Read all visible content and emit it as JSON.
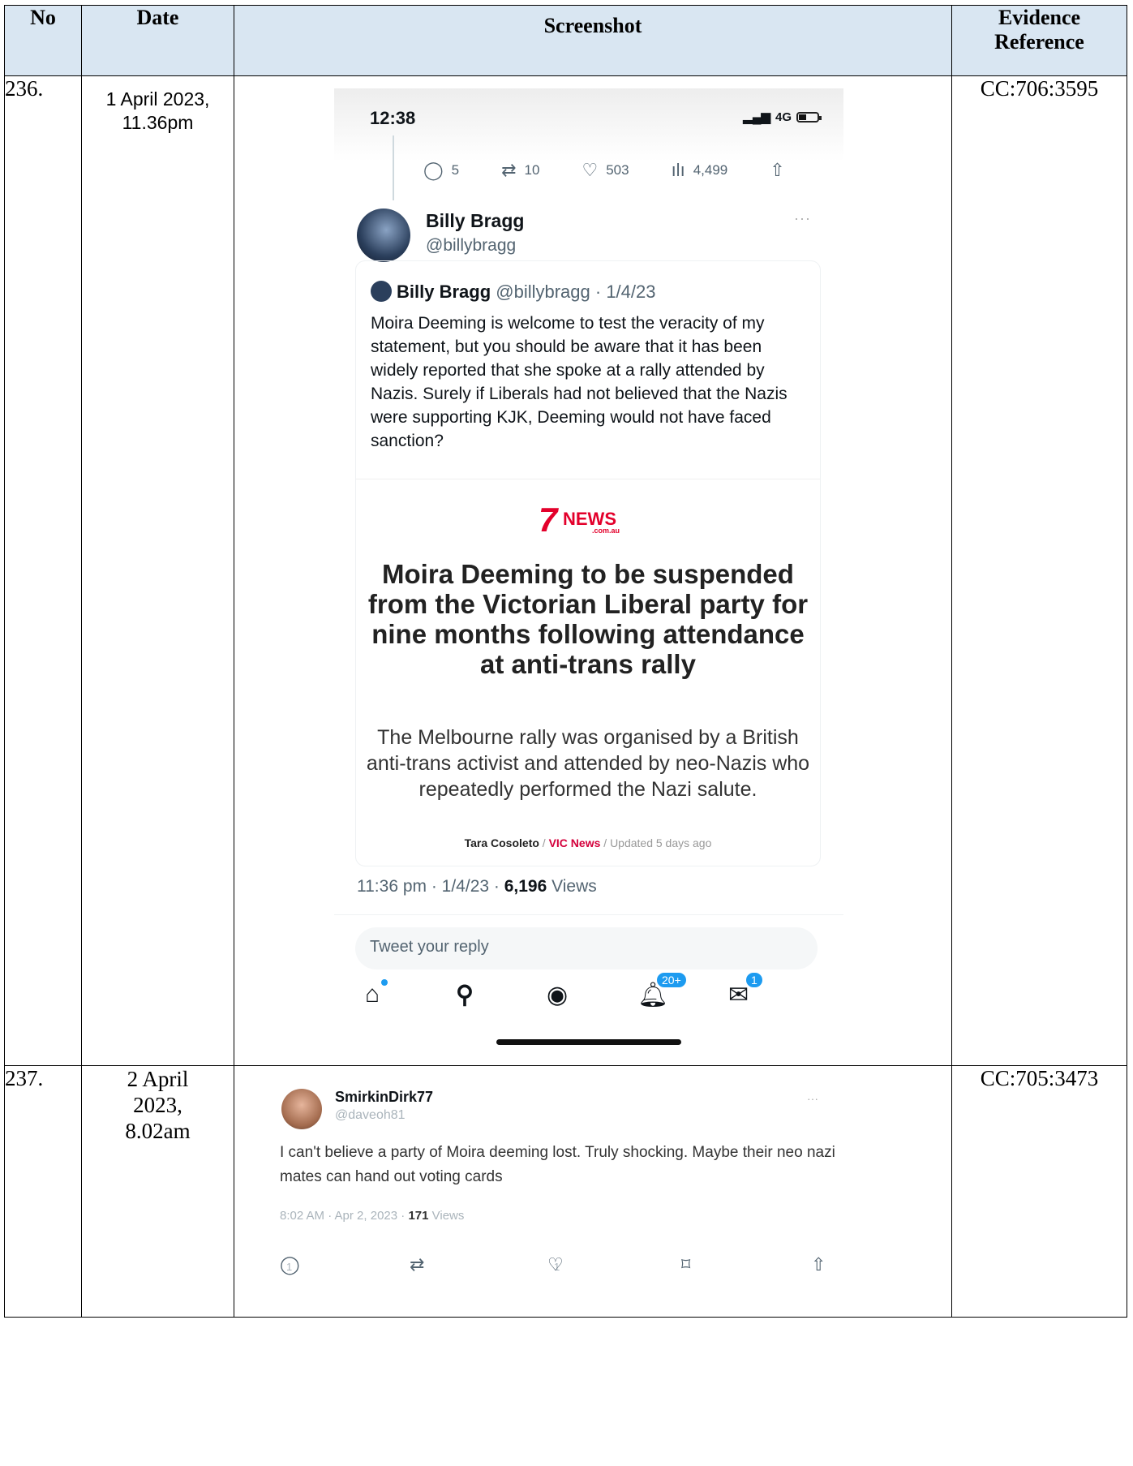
{
  "table": {
    "headers": {
      "no": "No",
      "date": "Date",
      "screenshot": "Screenshot",
      "reference_line1": "Evidence",
      "reference_line2": "Reference"
    },
    "rows": [
      {
        "no": "236.",
        "date_line1": "1 April 2023,",
        "date_line2": "11.36pm",
        "reference": "CC:706:3595"
      },
      {
        "no": "237.",
        "date_line1": "2 April",
        "date_line2": "2023,",
        "date_line3": "8.02am",
        "reference": "CC:705:3473"
      }
    ]
  },
  "phone": {
    "status_time": "12:38",
    "network": "4G",
    "actions": {
      "replies": "5",
      "retweets": "10",
      "likes": "503",
      "views": "4,499"
    },
    "author_name": "Billy Bragg",
    "author_handle": "@billybragg",
    "quote": {
      "name": "Billy Bragg",
      "handle_date": "@billybragg · 1/4/23",
      "text": "Moira Deeming is welcome to test the veracity of my statement, but you should be aware that it has been widely reported that she spoke at a rally attended by Nazis. Surely if Liberals had not believed that the Nazis were supporting KJK, Deeming would not have faced sanction?"
    },
    "card": {
      "logo_seven": "7",
      "logo_news": "NEWS",
      "logo_domain": ".com.au",
      "title": "Moira Deeming to be suspended from the Victorian Liberal party for nine months following attendance at anti-trans rally",
      "subtitle": "The Melbourne rally was organised by a British anti-trans activist and attended by neo-Nazis who repeatedly performed the Nazi salute.",
      "byline_author": "Tara Cosoleto",
      "byline_section": "VIC News",
      "byline_updated": "Updated 5 days ago",
      "sep1": " / ",
      "sep2": " / "
    },
    "meta_time": "11:36 pm · 1/4/23 · ",
    "meta_views_count": "6,196",
    "meta_views_label": " Views",
    "reply_placeholder": "Tweet your reply",
    "notifications_badge": "20+",
    "messages_badge": "1",
    "icons": [
      "home-icon",
      "search-icon",
      "spaces-icon",
      "notifications-icon",
      "messages-icon"
    ]
  },
  "tweet2": {
    "name": "SmirkinDirk77",
    "handle": "@daveoh81",
    "text": "I can't believe a party of Moira deeming lost. Truly shocking. Maybe their neo nazi mates can hand out voting cards",
    "meta_time": "8:02 AM · Apr 2, 2023 · ",
    "meta_views_count": "171",
    "meta_views_label": " Views",
    "replies": "1",
    "likes": "1"
  }
}
